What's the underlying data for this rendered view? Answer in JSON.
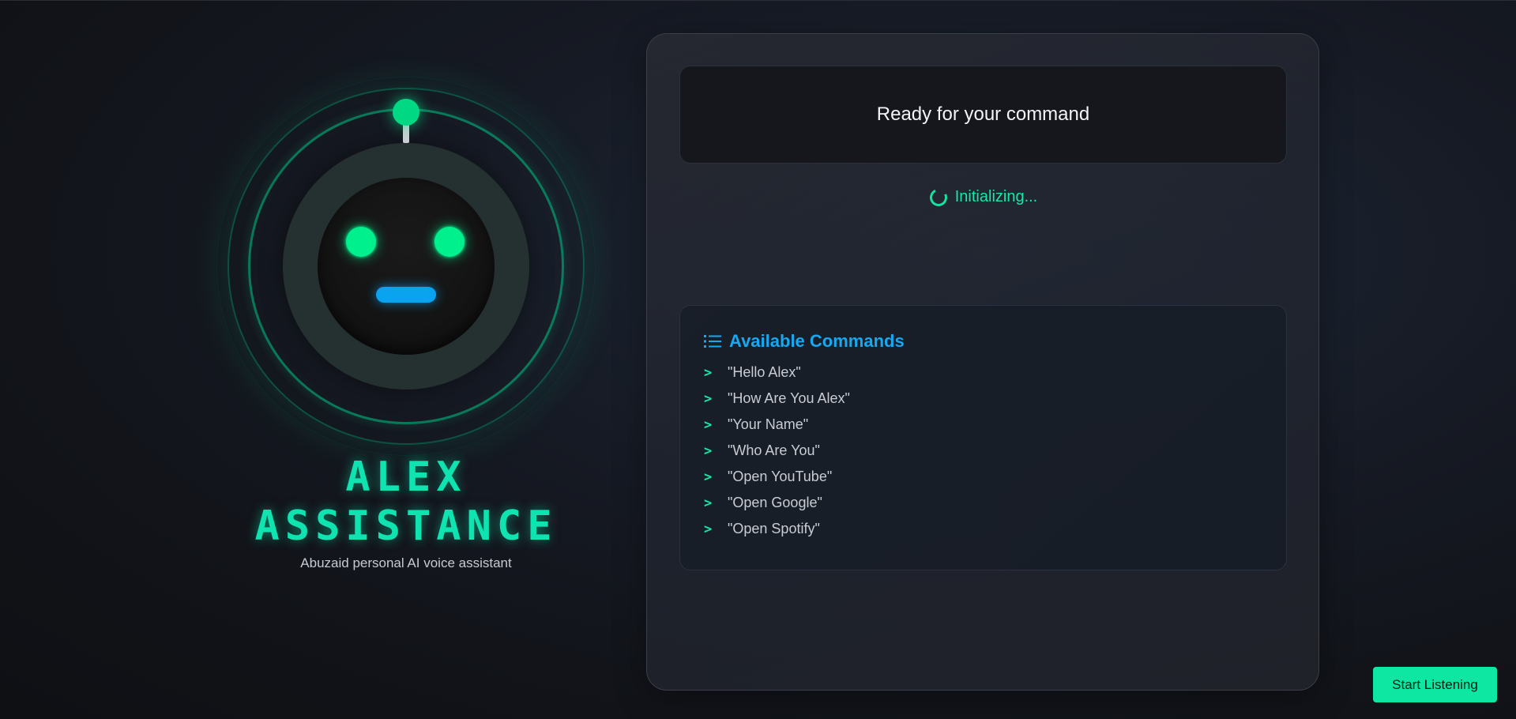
{
  "brand": {
    "title_line1": "ALEX",
    "title_line2": "ASSISTANCE",
    "subtitle": "Abuzaid personal AI voice assistant"
  },
  "status": {
    "message": "Ready for your command",
    "state_text": "Initializing..."
  },
  "commands": {
    "title": "Available Commands",
    "bullet": ">",
    "items": [
      "\"Hello Alex\"",
      "\"How Are You Alex\"",
      "\"Your Name\"",
      "\"Who Are You\"",
      "\"Open YouTube\"",
      "\"Open Google\"",
      "\"Open Spotify\""
    ]
  },
  "actions": {
    "start_label": "Start Listening"
  },
  "colors": {
    "accent_green": "#0de7a1",
    "accent_blue": "#16a8f0",
    "background": "#111318"
  },
  "icons": {
    "commands_header": "list-icon",
    "status_spinner": "spinner-icon"
  }
}
